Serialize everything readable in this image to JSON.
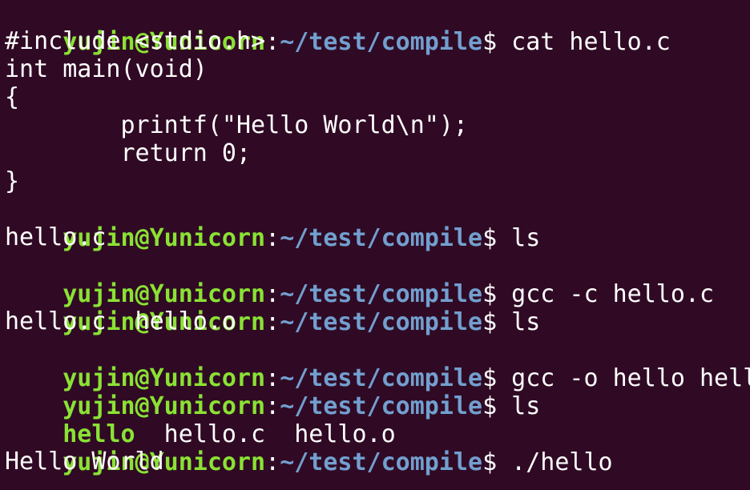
{
  "colors": {
    "background": "#300a24",
    "prompt_user": "#8ae234",
    "prompt_path": "#729fcf",
    "text": "#ffffff",
    "executable": "#8ae234"
  },
  "prompt": {
    "user_host": "yujin@Yunicorn",
    "separator": ":",
    "path": "~/test/compile",
    "symbol": "$"
  },
  "lines": {
    "l0_cmd": " cat hello.c",
    "l1": "#include <stdio.h>",
    "l2": "int main(void)",
    "l3": "{",
    "l4": "        printf(\"Hello World\\n\");",
    "l5": "        return 0;",
    "l6": "}",
    "l7_cmd": " ls",
    "l8": "hello.c",
    "l9_cmd": " gcc -c hello.c",
    "l10_cmd": " ls",
    "l11": "hello.c  hello.o",
    "l12_cmd": " gcc -o hello hello.c",
    "l13_cmd": " ls",
    "l14_exec": "hello",
    "l14_rest": "  hello.c  hello.o",
    "l15_cmd": " ./hello",
    "l16": "Hello World"
  }
}
